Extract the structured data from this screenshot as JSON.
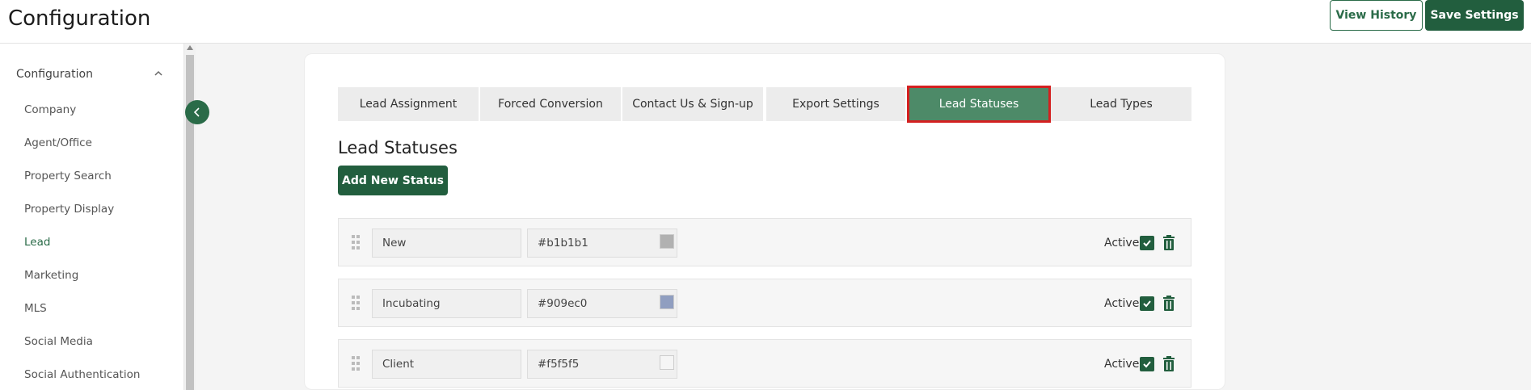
{
  "header": {
    "title": "Configuration",
    "view_history_label": "View History",
    "save_settings_label": "Save Settings"
  },
  "sidebar": {
    "heading": "Configuration",
    "items": [
      {
        "label": "Company"
      },
      {
        "label": "Agent/Office"
      },
      {
        "label": "Property Search"
      },
      {
        "label": "Property Display"
      },
      {
        "label": "Lead",
        "active": true
      },
      {
        "label": "Marketing"
      },
      {
        "label": "MLS"
      },
      {
        "label": "Social Media"
      },
      {
        "label": "Social Authentication"
      }
    ]
  },
  "tabs": [
    {
      "label": "Lead Assignment"
    },
    {
      "label": "Forced Conversion"
    },
    {
      "label": "Contact Us & Sign-up"
    },
    {
      "label": "Export Settings"
    },
    {
      "label": "Lead Statuses",
      "active": true
    },
    {
      "label": "Lead Types"
    }
  ],
  "main": {
    "section_title": "Lead Statuses",
    "add_button_label": "Add New Status",
    "statuses": [
      {
        "name": "New",
        "color": "#b1b1b1",
        "active_label": "Active",
        "active": true
      },
      {
        "name": "Incubating",
        "color": "#909ec0",
        "active_label": "Active",
        "active": true
      },
      {
        "name": "Client",
        "color": "#f5f5f5",
        "active_label": "Active",
        "active": true
      }
    ]
  },
  "colors": {
    "brand": "#225e3e",
    "active_tab": "#4d8a68",
    "highlight": "#d42020"
  }
}
